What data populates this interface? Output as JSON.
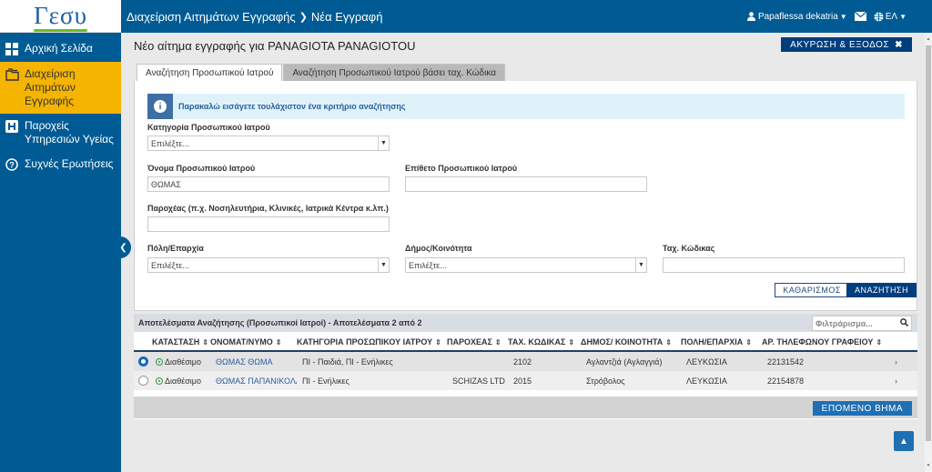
{
  "logo": {
    "text": "Γεσυ"
  },
  "sidebar": {
    "items": [
      {
        "label": "Αρχική Σελίδα",
        "icon": "grid-icon"
      },
      {
        "label": "Διαχείριση Αιτημάτων Εγγραφής",
        "icon": "folder-icon"
      },
      {
        "label": "Παροχείς Υπηρεσιών Υγείας",
        "icon": "hospital-icon"
      },
      {
        "label": "Συχνές Ερωτήσεις",
        "icon": "question-icon"
      }
    ]
  },
  "header": {
    "breadcrumb": [
      "Διαχείριση Αιτημάτων Εγγραφής",
      "Νέα Εγγραφή"
    ],
    "user": "Papaflessa dekatria",
    "lang": "ΕΛ"
  },
  "page": {
    "title": "Νέο αίτημα εγγραφής για PANAGIOTA PANAGIOTOU",
    "cancel_label": "ΑΚΥΡΩΣΗ & ΕΞΟΔΟΣ"
  },
  "tabs": [
    "Αναζήτηση Προσωπικού Ιατρού",
    "Αναζήτηση Προσωπικού Ιατρού βάσει ταχ. Κώδικα"
  ],
  "form": {
    "info": "Παρακαλώ εισάγετε τουλάχιστον ένα κριτήριο αναζήτησης",
    "category_label": "Κατηγορία Προσωπικού Ιατρού",
    "category_value": "Επιλέξτε...",
    "firstname_label": "Όνομα Προσωπικού Ιατρού",
    "firstname_value": "ΘΩΜΑΣ",
    "lastname_label": "Επίθετο Προσωπικού Ιατρού",
    "lastname_value": "",
    "provider_label": "Παροχέας (π.χ. Νοσηλευτήρια, Κλινικές, Ιατρικά Κέντρα κ.λπ.)",
    "provider_value": "",
    "city_label": "Πόλη/Επαρχία",
    "city_value": "Επιλέξτε...",
    "municipality_label": "Δήμος/Κοινότητα",
    "municipality_value": "Επιλέξτε...",
    "postal_label": "Ταχ. Κώδικας",
    "postal_value": "",
    "clear_label": "ΚΑΘΑΡΙΣΜΟΣ",
    "search_label": "ΑΝΑΖΗΤΗΣΗ"
  },
  "results": {
    "title": "Αποτελέσματα Αναζήτησης (Προσωπικοί Ιατροί) - Αποτελέσματα 2 από 2",
    "filter_placeholder": "Φιλτράρισμα...",
    "columns": [
      "ΚΑΤΑΣΤΑΣΗ",
      "ΟΝΟΜΑΤ/ΝΥΜΟ",
      "ΚΑΤΗΓΟΡΙΑ ΠΡΟΣΩΠΙΚΟΥ ΙΑΤΡΟΥ",
      "ΠΑΡΟΧΕΑΣ",
      "ΤΑΧ. ΚΩΔΙΚΑΣ",
      "ΔΗΜΟΣ/ ΚΟΙΝΟΤΗΤΑ",
      "ΠΟΛΗ/ΕΠΑΡΧΙΑ",
      "ΑΡ. ΤΗΛΕΦΩΝΟΥ ΓΡΑΦΕΙΟΥ"
    ],
    "rows": [
      {
        "status": "Διαθέσιμο",
        "name": "ΘΩΜΑΣ ΘΩΜΑ",
        "category": "ΠΙ - Παιδιά, ΠΙ - Ενήλικες",
        "provider": "",
        "postal": "2102",
        "municipality": "Αγλαντζιά (Αγλαγγιά)",
        "city": "ΛΕΥΚΩΣΙΑ",
        "phone": "22131542"
      },
      {
        "status": "Διαθέσιμο",
        "name": "ΘΩΜΑΣ ΠΑΠΑΝΙΚΟΛΑ",
        "category": "ΠΙ - Ενήλικες",
        "provider": "SCHIZAS LTD",
        "postal": "2015",
        "municipality": "Στρόβολος",
        "city": "ΛΕΥΚΩΣΙΑ",
        "phone": "22154878"
      }
    ]
  },
  "next_label": "ΕΠΟΜΕΝΟ ΒΗΜΑ",
  "colors": {
    "primary": "#005b94",
    "active_nav": "#f4b400",
    "button": "#003e7e"
  }
}
